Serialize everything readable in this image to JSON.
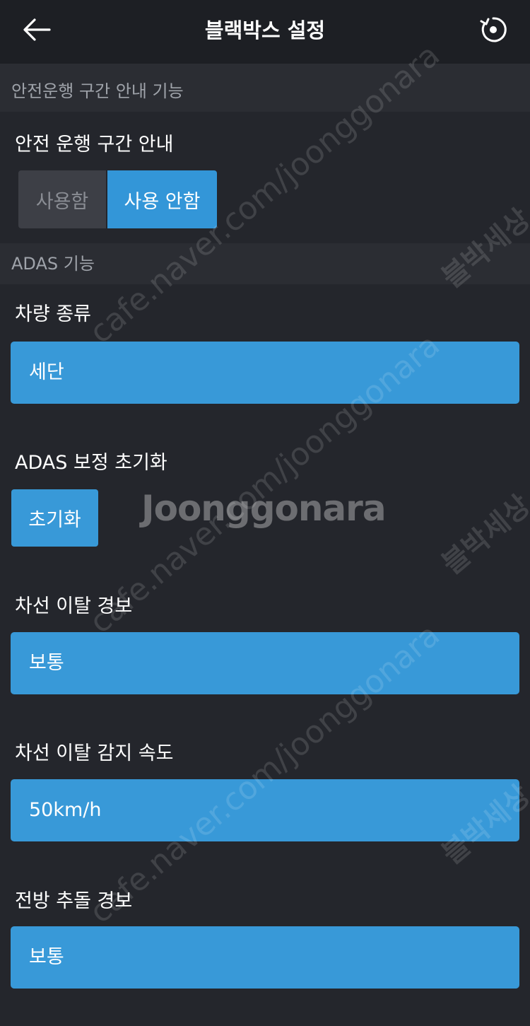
{
  "header": {
    "title": "블랙박스 설정",
    "back_icon": "back-arrow-icon",
    "reset_icon": "reset-icon"
  },
  "safety_section": {
    "title": "안전운행 구간 안내 기능",
    "setting": {
      "label": "안전 운행 구간 안내",
      "options": [
        "사용함",
        "사용 안함"
      ],
      "selected": "사용 안함"
    }
  },
  "adas_section": {
    "title": "ADAS 기능",
    "vehicle_type": {
      "label": "차량 종류",
      "value": "세단"
    },
    "adas_reset": {
      "label": "ADAS 보정 초기화",
      "button": "초기화"
    },
    "lane_departure_warning": {
      "label": "차선 이탈 경보",
      "value": "보통"
    },
    "lane_departure_speed": {
      "label": "차선 이탈 감지 속도",
      "value": "50km/h"
    },
    "forward_collision_warning": {
      "label": "전방 추돌 경보",
      "value": "보통"
    }
  },
  "watermark": {
    "url": "cafe.naver.com/joonggonara",
    "korean": "블박세상",
    "logo": "Joonggonara"
  },
  "colors": {
    "background": "#24262c",
    "header": "#1d1f24",
    "section_header": "#2b2d33",
    "accent": "#3899d8",
    "inactive": "#3d3f46"
  }
}
